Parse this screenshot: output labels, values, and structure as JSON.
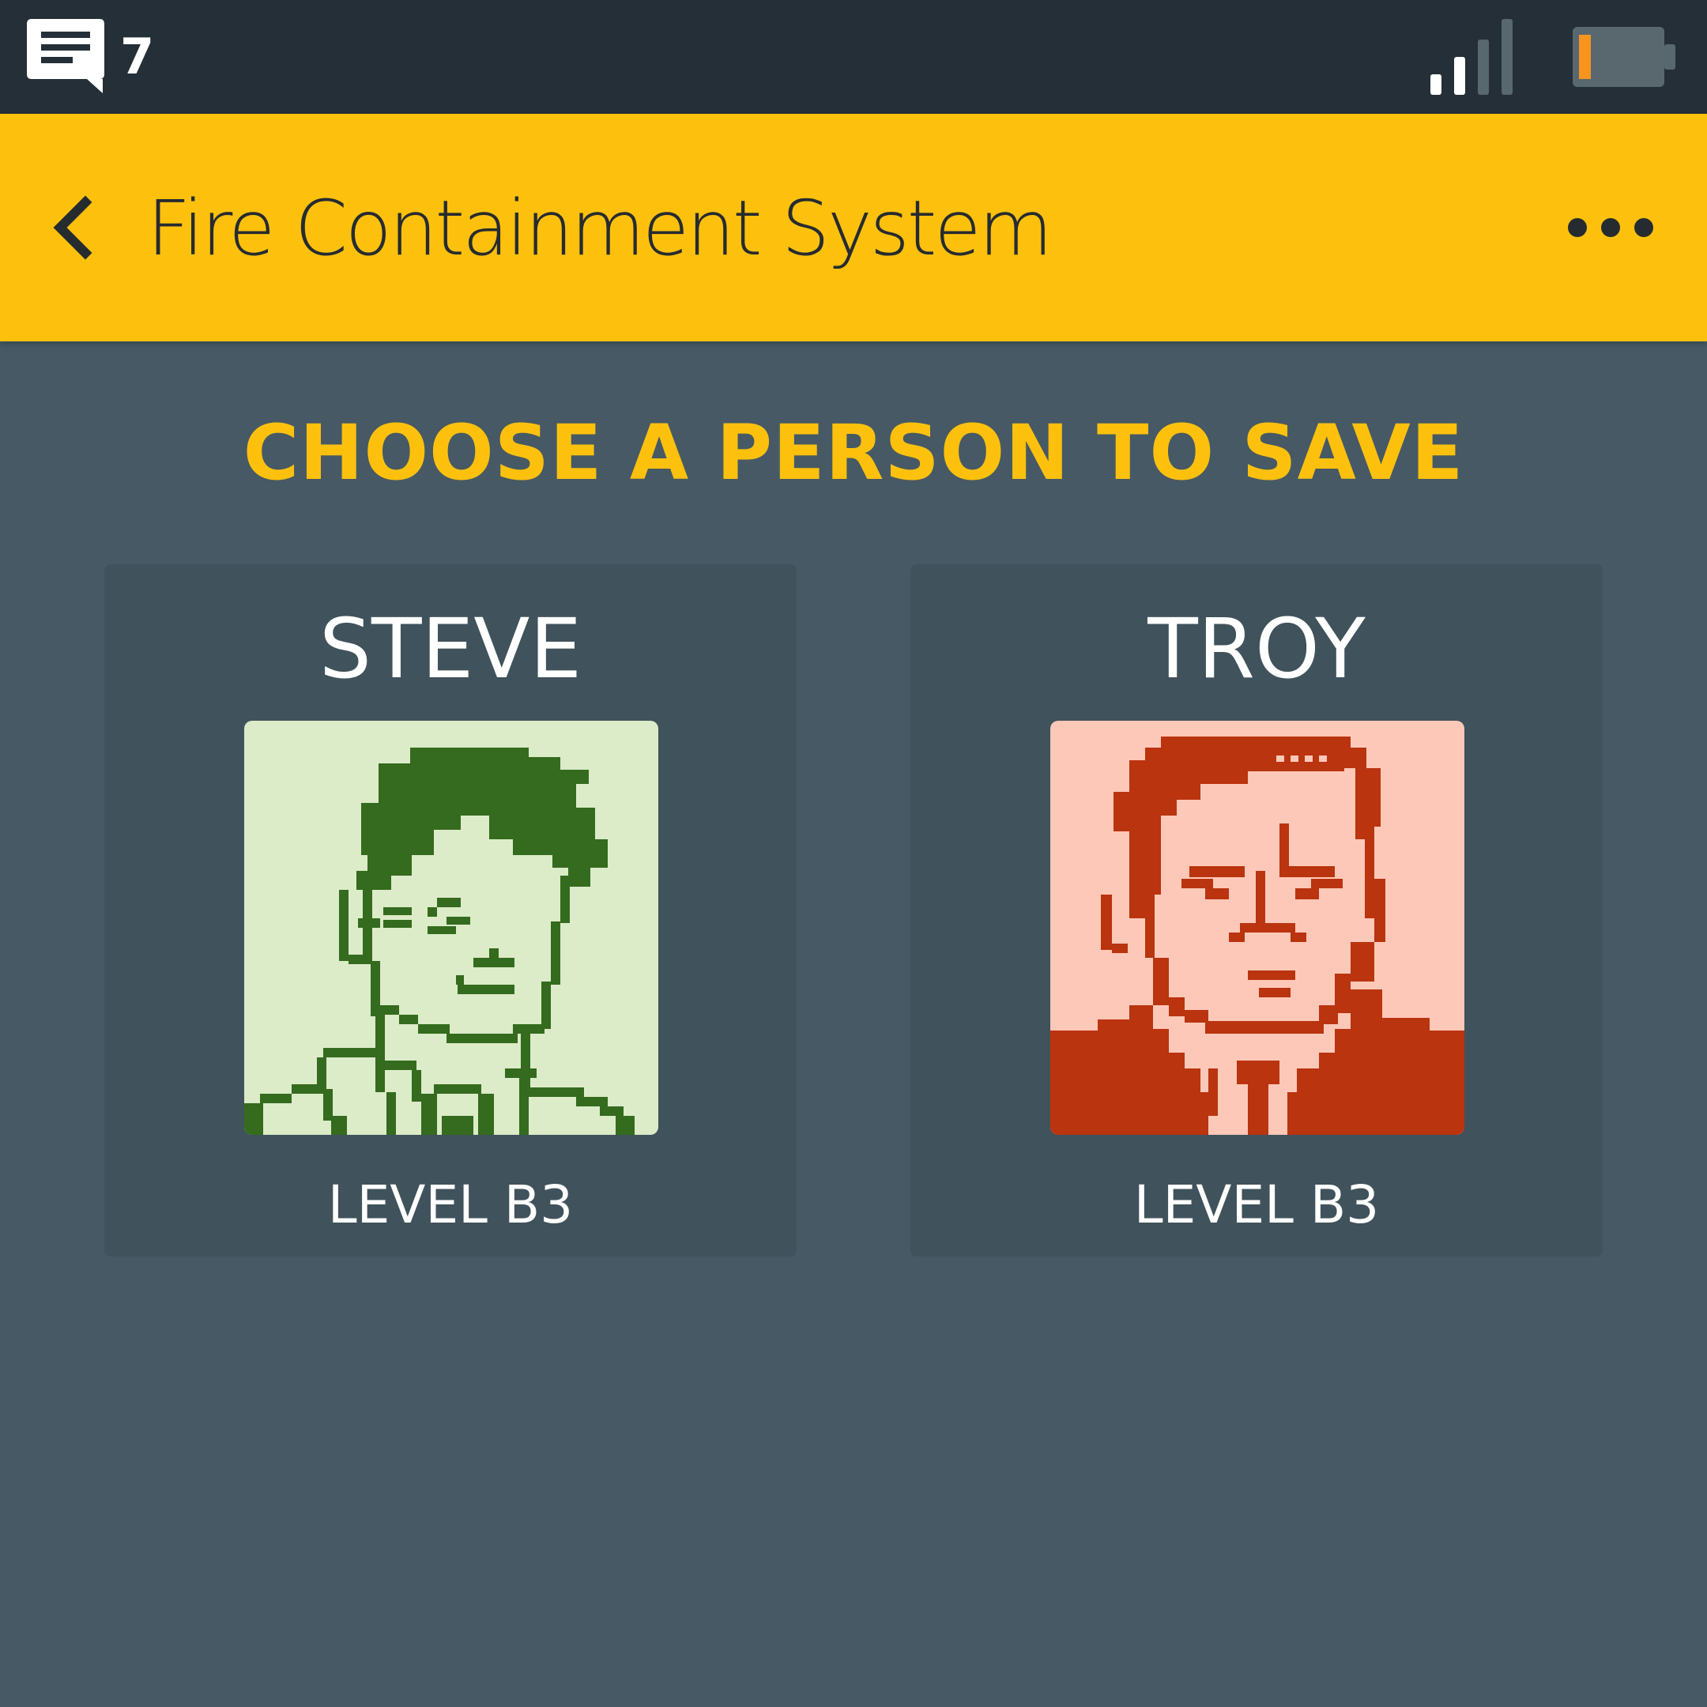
{
  "status_bar": {
    "message_icon": "message-icon",
    "message_count": "7",
    "signal_icon": "signal-icon",
    "battery_icon": "battery-icon",
    "battery_level": 0.15,
    "battery_color": "#f7941d"
  },
  "app_bar": {
    "back_icon": "back-arrow-icon",
    "title": "Fire Containment System",
    "more_icon": "more-icon",
    "color": "#fdc10d"
  },
  "heading": "CHOOSE A PERSON TO SAVE",
  "people": [
    {
      "name": "STEVE",
      "level": "LEVEL B3",
      "portrait_bg": "#dcebc8",
      "portrait_fg": "#346b1e"
    },
    {
      "name": "TROY",
      "level": "LEVEL B3",
      "portrait_bg": "#fdc8b8",
      "portrait_fg": "#b9340f"
    }
  ]
}
